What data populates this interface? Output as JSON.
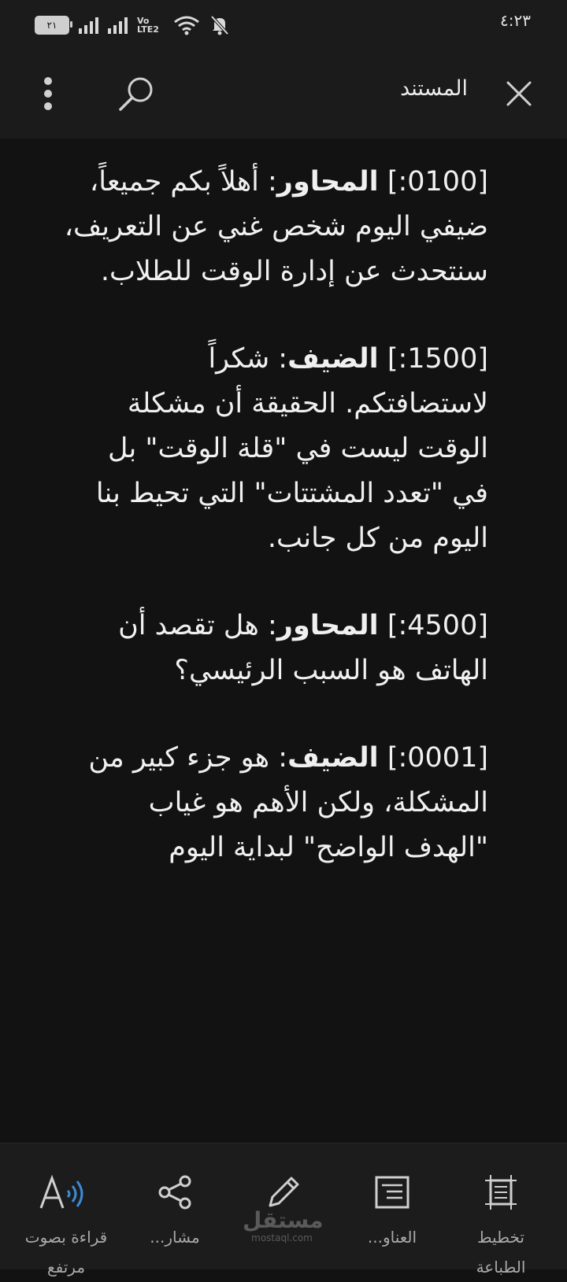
{
  "status_bar": {
    "time": "٤:٢٣",
    "battery": "٢١",
    "network": "Vo LTE2"
  },
  "toolbar": {
    "title": "المستند"
  },
  "paragraphs": [
    {
      "timestamp": "[0100:]",
      "speaker": "المحاور",
      "text": ": أهلاً بكم جميعاً، ضيفي اليوم شخص غني عن التعريف، سنتحدث عن إدارة الوقت للطلاب."
    },
    {
      "timestamp": "[1500:]",
      "speaker": "الضيف",
      "text": ": شكراً لاستضافتكم. الحقيقة أن مشكلة الوقت ليست في \"قلة الوقت\" بل في \"تعدد المشتتات\" التي تحيط بنا اليوم من كل جانب."
    },
    {
      "timestamp": "[4500:]",
      "speaker": "المحاور",
      "text": ": هل تقصد أن الهاتف هو السبب الرئيسي؟"
    },
    {
      "timestamp": "[0001:]",
      "speaker": "الضيف",
      "text": ": هو جزء كبير من المشكلة، ولكن الأهم هو غياب \"الهدف الواضح\" لبداية اليوم"
    }
  ],
  "bottom_bar": {
    "items": [
      {
        "label": "قراءة بصوت\nمرتفع",
        "icon": "read-aloud-icon"
      },
      {
        "label": "مشار...",
        "icon": "share-icon"
      },
      {
        "label": "",
        "icon": "pen-icon"
      },
      {
        "label": "العناو...",
        "icon": "headings-icon"
      },
      {
        "label": "تخطيط\nالطباعة",
        "icon": "print-layout-icon"
      }
    ]
  },
  "watermark": {
    "main": "مستقل",
    "sub": "mostaql.com"
  }
}
